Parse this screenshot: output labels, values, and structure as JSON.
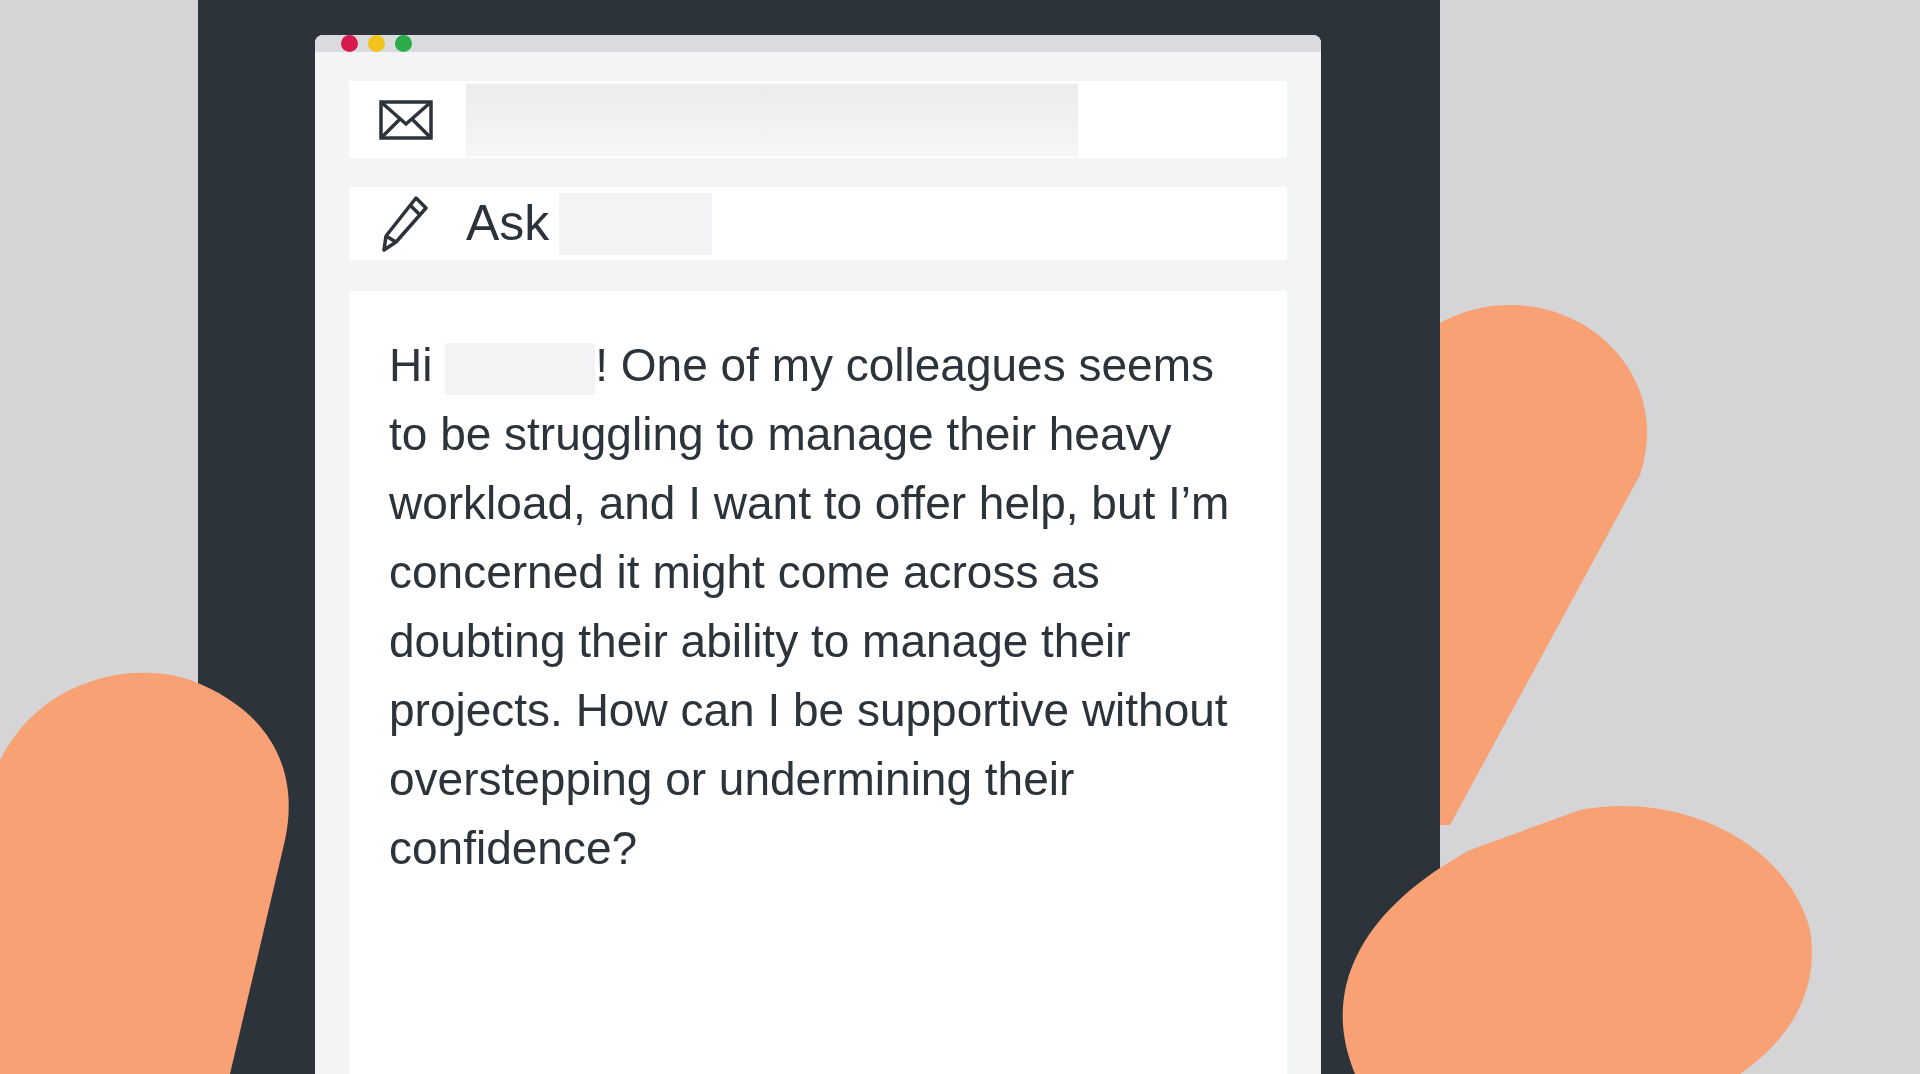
{
  "window": {
    "controls": [
      {
        "color": "#d81b4f"
      },
      {
        "color": "#f2c31b"
      },
      {
        "color": "#2bab4a"
      }
    ]
  },
  "recipient": {
    "redacted": true
  },
  "subject": {
    "prefix": "Ask",
    "redacted": true
  },
  "body": {
    "greeting": "Hi",
    "redacted_name": true,
    "text": "! One of my colleagues seems to be struggling to manage their heavy workload, and I want to offer help, but I’m concerned it might come across as doubting their ability to manage their projects. How can I be supportive without overstepping or undermining their confidence?"
  }
}
